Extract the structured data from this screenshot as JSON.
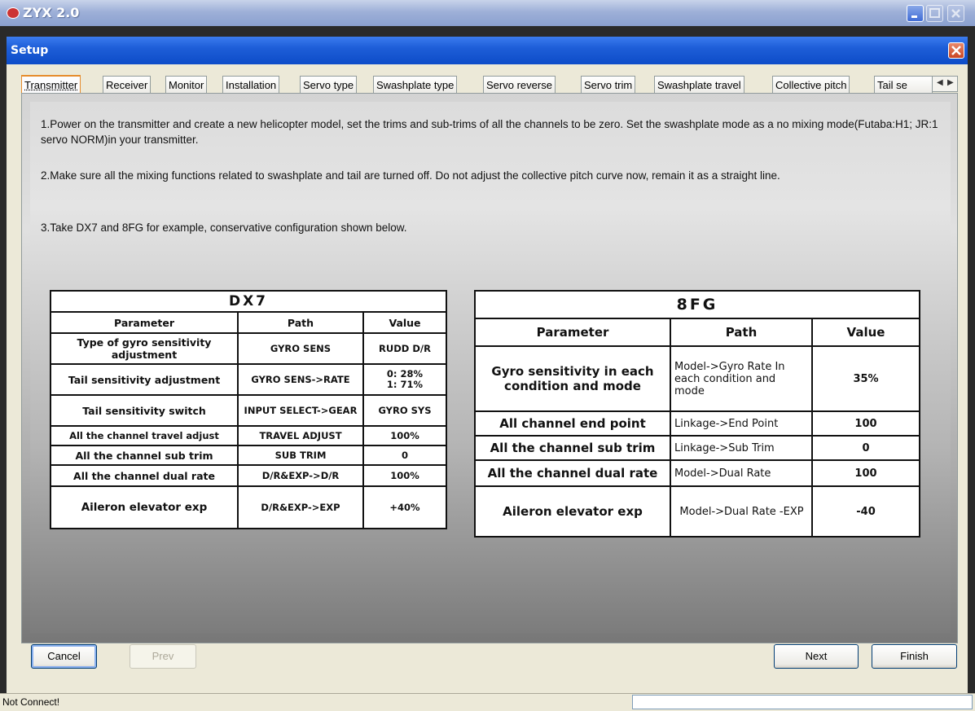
{
  "window": {
    "title": "ZYX 2.0"
  },
  "dialog": {
    "title": "Setup"
  },
  "tabs": [
    {
      "label": "Transmitter",
      "active": true
    },
    {
      "label": "Receiver"
    },
    {
      "label": "Monitor"
    },
    {
      "label": "Installation"
    },
    {
      "label": "Servo type"
    },
    {
      "label": "Swashplate type"
    },
    {
      "label": "Servo reverse"
    },
    {
      "label": "Servo trim"
    },
    {
      "label": "Swashplate travel"
    },
    {
      "label": "Collective pitch"
    },
    {
      "label": "Tail se"
    }
  ],
  "instructions": [
    "1.Power on the transmitter and create a new helicopter model, set the trims and sub-trims of all the channels to be zero. Set the swashplate mode as a no mixing mode(Futaba:H1; JR:1 servo NORM)in your transmitter.",
    "2.Make sure all the mixing functions related to swashplate and tail are turned off. Do not adjust the collective pitch curve now, remain it as a straight line.",
    "3.Take DX7 and 8FG for example, conservative configuration shown below."
  ],
  "dx7": {
    "title": "DX7",
    "headers": [
      "Parameter",
      "Path",
      "Value"
    ],
    "rows": [
      [
        "Type of gyro sensitivity adjustment",
        "GYRO SENS",
        "RUDD D/R"
      ],
      [
        "Tail sensitivity adjustment",
        "GYRO SENS->RATE",
        "0: 28%\n1: 71%"
      ],
      [
        "Tail sensitivity switch",
        "INPUT SELECT->GEAR",
        "GYRO SYS"
      ],
      [
        "All the channel travel adjust",
        "TRAVEL ADJUST",
        "100%"
      ],
      [
        "All the channel sub trim",
        "SUB TRIM",
        "0"
      ],
      [
        "All the channel dual rate",
        "D/R&EXP->D/R",
        "100%"
      ],
      [
        "Aileron elevator exp",
        "D/R&EXP->EXP",
        "+40%"
      ]
    ]
  },
  "fg8": {
    "title": "8FG",
    "headers": [
      "Parameter",
      "Path",
      "Value"
    ],
    "rows": [
      [
        "Gyro sensitivity in each condition and mode",
        "Model->Gyro Rate In each condition and mode",
        "35%"
      ],
      [
        "All channel end point",
        "Linkage->End Point",
        "100"
      ],
      [
        "All the channel sub trim",
        "Linkage->Sub Trim",
        "0"
      ],
      [
        "All the channel dual rate",
        "Model->Dual Rate",
        "100"
      ],
      [
        "Aileron elevator exp",
        "Model->Dual Rate -EXP",
        "-40"
      ]
    ]
  },
  "buttons": {
    "cancel": "Cancel",
    "prev": "Prev",
    "next": "Next",
    "finish": "Finish"
  },
  "status": {
    "text": "Not Connect!"
  }
}
